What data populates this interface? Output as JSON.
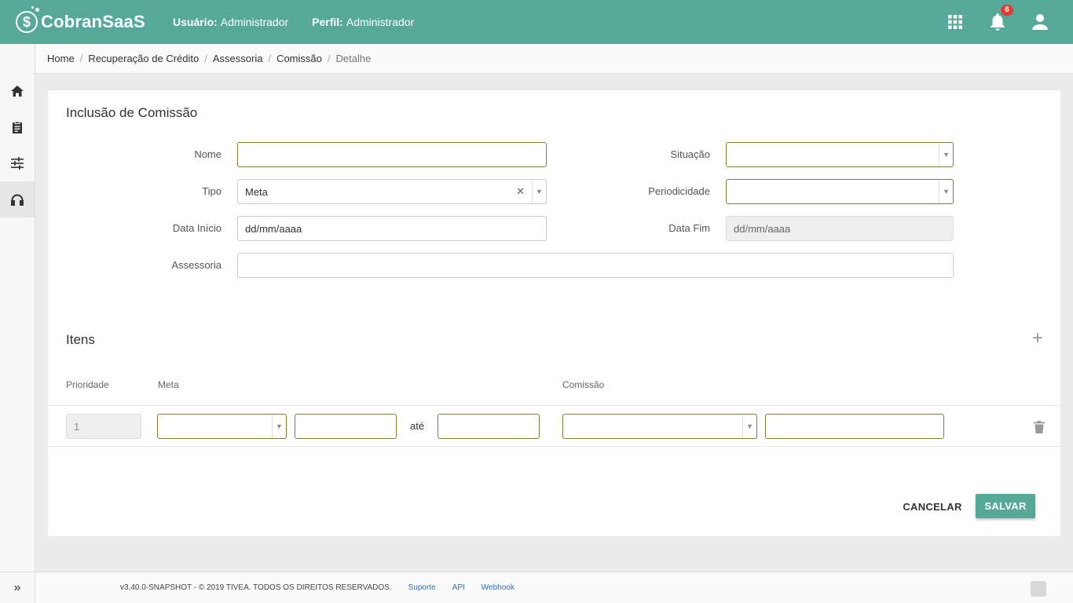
{
  "app": {
    "brand": "CobranSaaS",
    "logo_glyph": "$"
  },
  "header": {
    "user_label": "Usuário:",
    "user_value": "Administrador",
    "profile_label": "Perfil:",
    "profile_value": "Administrador",
    "notification_count": "6",
    "icons": [
      "apps-grid-icon",
      "bell-icon",
      "user-icon"
    ]
  },
  "sidebar": {
    "items": [
      {
        "name": "home-icon"
      },
      {
        "name": "clipboard-icon"
      },
      {
        "name": "sliders-icon"
      },
      {
        "name": "headset-icon",
        "active": true
      }
    ],
    "expand_glyph": "»"
  },
  "breadcrumb": [
    "Home",
    "Recuperação de Crédito",
    "Assessoria",
    "Comissão",
    "Detalhe"
  ],
  "form": {
    "title": "Inclusão de Comissão",
    "nome_label": "Nome",
    "nome_value": "",
    "tipo_label": "Tipo",
    "tipo_value": "Meta",
    "data_inicio_label": "Data Início",
    "data_inicio_placeholder": "dd/mm/aaaa",
    "assessoria_label": "Assessoria",
    "assessoria_value": "",
    "situacao_label": "Situação",
    "situacao_value": "",
    "periodicidade_label": "Periodicidade",
    "periodicidade_value": "",
    "data_fim_label": "Data Fim",
    "data_fim_placeholder": "dd/mm/aaaa"
  },
  "itens": {
    "title": "Itens",
    "add_glyph": "+",
    "columns": {
      "prioridade": "Prioridade",
      "meta": "Meta",
      "comissao": "Comissão"
    },
    "rows": [
      {
        "prioridade": "1",
        "meta_tipo": "",
        "meta_de": "",
        "ate_label": "até",
        "meta_ate": "",
        "comissao_tipo": "",
        "comissao_valor": ""
      }
    ]
  },
  "actions": {
    "cancel": "CANCELAR",
    "save": "SALVAR"
  },
  "footer": {
    "version": "v3.40.0-SNAPSHOT - © 2019 TIVEA. TODOS OS DIREITOS RESERVADOS.",
    "links": [
      "Suporte",
      "API",
      "Webhook"
    ]
  },
  "colors": {
    "primary": "#56a898",
    "badge": "#e53935",
    "focus_border": "#8a7a3a",
    "link": "#2f6fb3"
  }
}
